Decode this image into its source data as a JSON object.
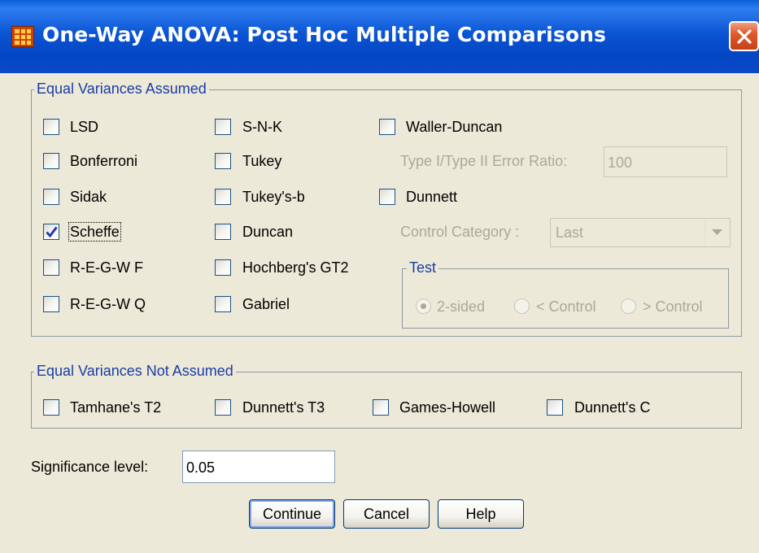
{
  "window": {
    "title": "One-Way ANOVA: Post Hoc Multiple Comparisons",
    "icon": "table-grid-icon",
    "close_icon": "close-icon"
  },
  "equal_assumed": {
    "legend": "Equal Variances Assumed",
    "col1": [
      {
        "label": "LSD",
        "checked": false
      },
      {
        "label": "Bonferroni",
        "checked": false
      },
      {
        "label": "Sidak",
        "checked": false
      },
      {
        "label": "Scheffe",
        "checked": true
      },
      {
        "label": "R-E-G-W F",
        "checked": false
      },
      {
        "label": "R-E-G-W Q",
        "checked": false
      }
    ],
    "col2": [
      {
        "label": "S-N-K",
        "checked": false
      },
      {
        "label": "Tukey",
        "checked": false
      },
      {
        "label": "Tukey's-b",
        "checked": false
      },
      {
        "label": "Duncan",
        "checked": false
      },
      {
        "label": "Hochberg's GT2",
        "checked": false
      },
      {
        "label": "Gabriel",
        "checked": false
      }
    ],
    "waller_duncan": {
      "label": "Waller-Duncan",
      "checked": false
    },
    "error_ratio": {
      "label": "Type I/Type II Error Ratio:",
      "value": "100"
    },
    "dunnett": {
      "label": "Dunnett",
      "checked": false
    },
    "control_category": {
      "label": "Control Category :",
      "value": "Last"
    },
    "test": {
      "legend": "Test",
      "options": [
        "2-sided",
        "< Control",
        "> Control"
      ],
      "selected": "2-sided"
    }
  },
  "equal_not_assumed": {
    "legend": "Equal Variances Not Assumed",
    "items": [
      {
        "label": "Tamhane's T2",
        "checked": false
      },
      {
        "label": "Dunnett's T3",
        "checked": false
      },
      {
        "label": "Games-Howell",
        "checked": false
      },
      {
        "label": "Dunnett's C",
        "checked": false
      }
    ]
  },
  "significance": {
    "label": "Significance level:",
    "value": "0.05"
  },
  "buttons": {
    "continue": "Continue",
    "cancel": "Cancel",
    "help": "Help"
  }
}
